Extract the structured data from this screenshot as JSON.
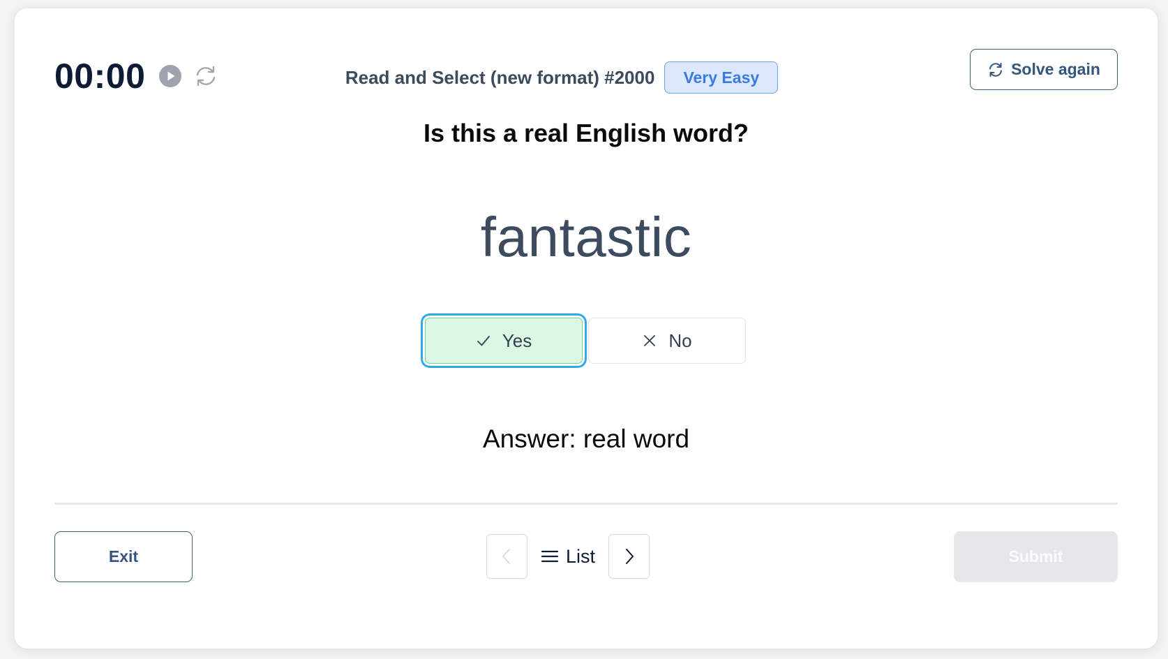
{
  "header": {
    "timer": "00:00",
    "play_icon": "play-circle-icon",
    "reset_icon": "refresh-icon",
    "puzzle_title": "Read and Select (new format) #2000",
    "difficulty_badge": "Very Easy",
    "solve_again_label": "Solve again"
  },
  "question": {
    "prompt": "Is this a real English word?",
    "word": "fantastic",
    "options": [
      {
        "label": "Yes",
        "icon": "check-icon",
        "selected": true
      },
      {
        "label": "No",
        "icon": "x-icon",
        "selected": false
      }
    ],
    "answer_text": "Answer: real word"
  },
  "footer": {
    "exit_label": "Exit",
    "prev_icon": "chevron-left-icon",
    "prev_disabled": true,
    "list_label": "List",
    "list_icon": "menu-icon",
    "next_icon": "chevron-right-icon",
    "submit_label": "Submit",
    "submit_disabled": true
  },
  "colors": {
    "selected_option_bg": "#dcf8e4",
    "focus_ring": "#2ea9ec",
    "badge_bg": "#dbe8fd",
    "badge_text": "#3b7be0",
    "primary_outline": "#3f5f86"
  }
}
